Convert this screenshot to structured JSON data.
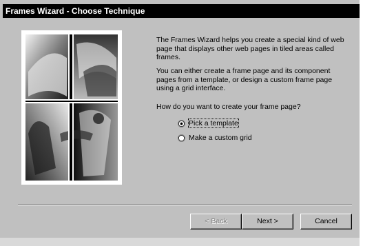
{
  "window": {
    "title": "Frames Wizard - Choose Technique"
  },
  "content": {
    "description_1": "The Frames Wizard helps you create a special kind of web page that displays other web pages in tiled areas called frames.",
    "description_2": "You can either create a frame page and its component pages from a template, or design a custom frame page using a grid interface.",
    "question": "How do you want to create your frame page?"
  },
  "options": [
    {
      "label": "Pick a template",
      "selected": true
    },
    {
      "label": "Make a custom grid",
      "selected": false
    }
  ],
  "buttons": {
    "back": "< Back",
    "next": "Next >",
    "cancel": "Cancel"
  }
}
